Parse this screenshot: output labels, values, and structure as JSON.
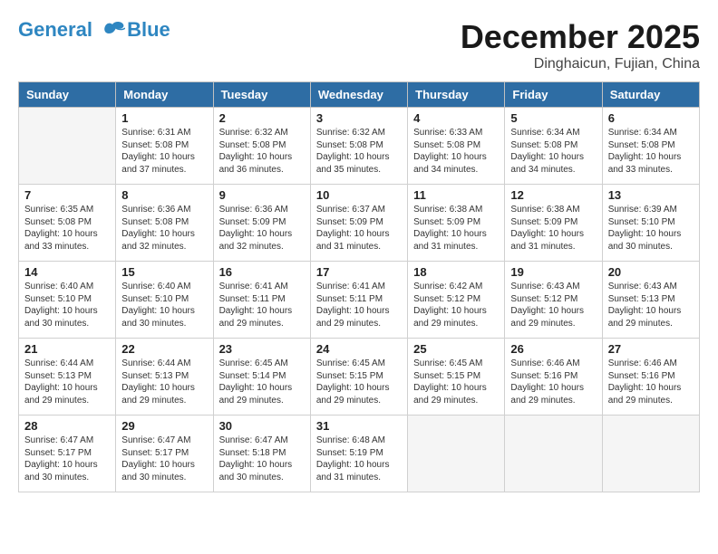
{
  "logo": {
    "line1": "General",
    "line2": "Blue"
  },
  "title": "December 2025",
  "subtitle": "Dinghaicun, Fujian, China",
  "days_of_week": [
    "Sunday",
    "Monday",
    "Tuesday",
    "Wednesday",
    "Thursday",
    "Friday",
    "Saturday"
  ],
  "weeks": [
    [
      {
        "day": "",
        "empty": true
      },
      {
        "day": "1",
        "sunrise": "6:31 AM",
        "sunset": "5:08 PM",
        "daylight": "10 hours and 37 minutes."
      },
      {
        "day": "2",
        "sunrise": "6:32 AM",
        "sunset": "5:08 PM",
        "daylight": "10 hours and 36 minutes."
      },
      {
        "day": "3",
        "sunrise": "6:32 AM",
        "sunset": "5:08 PM",
        "daylight": "10 hours and 35 minutes."
      },
      {
        "day": "4",
        "sunrise": "6:33 AM",
        "sunset": "5:08 PM",
        "daylight": "10 hours and 34 minutes."
      },
      {
        "day": "5",
        "sunrise": "6:34 AM",
        "sunset": "5:08 PM",
        "daylight": "10 hours and 34 minutes."
      },
      {
        "day": "6",
        "sunrise": "6:34 AM",
        "sunset": "5:08 PM",
        "daylight": "10 hours and 33 minutes."
      }
    ],
    [
      {
        "day": "7",
        "sunrise": "6:35 AM",
        "sunset": "5:08 PM",
        "daylight": "10 hours and 33 minutes."
      },
      {
        "day": "8",
        "sunrise": "6:36 AM",
        "sunset": "5:08 PM",
        "daylight": "10 hours and 32 minutes."
      },
      {
        "day": "9",
        "sunrise": "6:36 AM",
        "sunset": "5:09 PM",
        "daylight": "10 hours and 32 minutes."
      },
      {
        "day": "10",
        "sunrise": "6:37 AM",
        "sunset": "5:09 PM",
        "daylight": "10 hours and 31 minutes."
      },
      {
        "day": "11",
        "sunrise": "6:38 AM",
        "sunset": "5:09 PM",
        "daylight": "10 hours and 31 minutes."
      },
      {
        "day": "12",
        "sunrise": "6:38 AM",
        "sunset": "5:09 PM",
        "daylight": "10 hours and 31 minutes."
      },
      {
        "day": "13",
        "sunrise": "6:39 AM",
        "sunset": "5:10 PM",
        "daylight": "10 hours and 30 minutes."
      }
    ],
    [
      {
        "day": "14",
        "sunrise": "6:40 AM",
        "sunset": "5:10 PM",
        "daylight": "10 hours and 30 minutes."
      },
      {
        "day": "15",
        "sunrise": "6:40 AM",
        "sunset": "5:10 PM",
        "daylight": "10 hours and 30 minutes."
      },
      {
        "day": "16",
        "sunrise": "6:41 AM",
        "sunset": "5:11 PM",
        "daylight": "10 hours and 29 minutes."
      },
      {
        "day": "17",
        "sunrise": "6:41 AM",
        "sunset": "5:11 PM",
        "daylight": "10 hours and 29 minutes."
      },
      {
        "day": "18",
        "sunrise": "6:42 AM",
        "sunset": "5:12 PM",
        "daylight": "10 hours and 29 minutes."
      },
      {
        "day": "19",
        "sunrise": "6:43 AM",
        "sunset": "5:12 PM",
        "daylight": "10 hours and 29 minutes."
      },
      {
        "day": "20",
        "sunrise": "6:43 AM",
        "sunset": "5:13 PM",
        "daylight": "10 hours and 29 minutes."
      }
    ],
    [
      {
        "day": "21",
        "sunrise": "6:44 AM",
        "sunset": "5:13 PM",
        "daylight": "10 hours and 29 minutes."
      },
      {
        "day": "22",
        "sunrise": "6:44 AM",
        "sunset": "5:13 PM",
        "daylight": "10 hours and 29 minutes."
      },
      {
        "day": "23",
        "sunrise": "6:45 AM",
        "sunset": "5:14 PM",
        "daylight": "10 hours and 29 minutes."
      },
      {
        "day": "24",
        "sunrise": "6:45 AM",
        "sunset": "5:15 PM",
        "daylight": "10 hours and 29 minutes."
      },
      {
        "day": "25",
        "sunrise": "6:45 AM",
        "sunset": "5:15 PM",
        "daylight": "10 hours and 29 minutes."
      },
      {
        "day": "26",
        "sunrise": "6:46 AM",
        "sunset": "5:16 PM",
        "daylight": "10 hours and 29 minutes."
      },
      {
        "day": "27",
        "sunrise": "6:46 AM",
        "sunset": "5:16 PM",
        "daylight": "10 hours and 29 minutes."
      }
    ],
    [
      {
        "day": "28",
        "sunrise": "6:47 AM",
        "sunset": "5:17 PM",
        "daylight": "10 hours and 30 minutes."
      },
      {
        "day": "29",
        "sunrise": "6:47 AM",
        "sunset": "5:17 PM",
        "daylight": "10 hours and 30 minutes."
      },
      {
        "day": "30",
        "sunrise": "6:47 AM",
        "sunset": "5:18 PM",
        "daylight": "10 hours and 30 minutes."
      },
      {
        "day": "31",
        "sunrise": "6:48 AM",
        "sunset": "5:19 PM",
        "daylight": "10 hours and 31 minutes."
      },
      {
        "day": "",
        "empty": true
      },
      {
        "day": "",
        "empty": true
      },
      {
        "day": "",
        "empty": true
      }
    ]
  ]
}
